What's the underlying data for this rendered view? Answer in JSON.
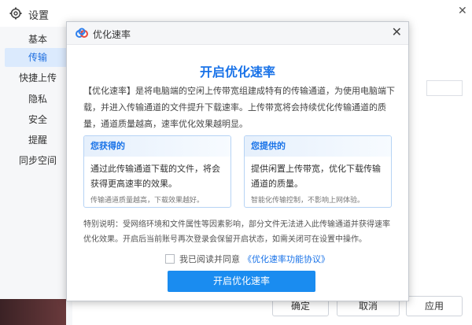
{
  "window": {
    "title": "设置",
    "close_glyph": "✕"
  },
  "sidebar": {
    "items": [
      {
        "label": "基本"
      },
      {
        "label": "传输",
        "active": true
      },
      {
        "label": "快捷上传"
      },
      {
        "label": "隐私"
      },
      {
        "label": "安全"
      },
      {
        "label": "提醒"
      },
      {
        "label": "同步空间"
      }
    ]
  },
  "footer_buttons": {
    "ok": "确定",
    "cancel": "取消",
    "apply": "应用"
  },
  "modal": {
    "title": "优化速率",
    "close_glyph": "✕",
    "heading": "开启优化速率",
    "description": "【优化速率】是将电脑端的空闲上传带宽组建成特有的传输通道，为使用电脑端下载，并进入传输通道的文件提升下载速率。上传带宽将会持续优化传输通道的质量，通道质量越高，速率优化效果越明显。",
    "cards": [
      {
        "heading": "您获得的",
        "body": "通过此传输通道下载的文件，将会获得更高速率的效果。",
        "foot": "传输通道质量越高，下载效果越好。"
      },
      {
        "heading": "您提供的",
        "body": "提供闲置上传带宽，优化下载传输通道的质量。",
        "foot": "智能化传输控制，不影响上网体验。"
      }
    ],
    "note": "特别说明：受网络环境和文件属性等因素影响，部分文件无法进入此传输通道并获得速率优化效果。开启后当前账号再次登录会保留开启状态，如需关闭可在设置中操作。",
    "agree_text": "我已阅读并同意",
    "agree_link": "《优化速率功能协议》",
    "agree_checked": false,
    "primary_button": "开启优化速率"
  },
  "colors": {
    "accent": "#1a73e8",
    "button": "#1a8cf0"
  }
}
